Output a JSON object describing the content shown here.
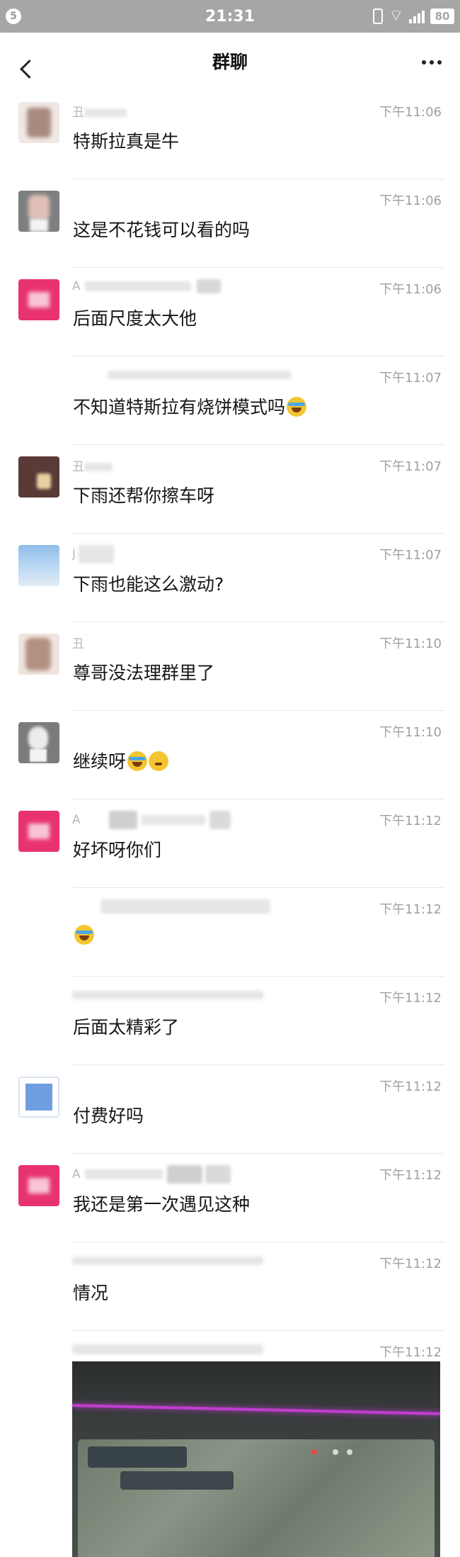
{
  "status_bar": {
    "notification_badge": "5",
    "time": "21:31",
    "battery": "80"
  },
  "header": {
    "title": "群聊"
  },
  "messages": [
    {
      "time": "下午11:06",
      "text": "特斯拉真是牛",
      "sender_prefix": "丑"
    },
    {
      "time": "下午11:06",
      "text": "这是不花钱可以看的吗",
      "sender_prefix": ""
    },
    {
      "time": "下午11:06",
      "text": "后面尺度太大他",
      "sender_prefix": "A"
    },
    {
      "time": "下午11:07",
      "text": "不知道特斯拉有烧饼模式吗",
      "sender_prefix": ""
    },
    {
      "time": "下午11:07",
      "text": "下雨还帮你擦车呀",
      "sender_prefix": "丑"
    },
    {
      "time": "下午11:07",
      "text": "下雨也能这么激动?",
      "sender_prefix": "J"
    },
    {
      "time": "下午11:10",
      "text": "尊哥没法理群里了",
      "sender_prefix": "丑"
    },
    {
      "time": "下午11:10",
      "text": "继续呀",
      "sender_prefix": ""
    },
    {
      "time": "下午11:12",
      "text": "好坏呀你们",
      "sender_prefix": "A"
    },
    {
      "time": "下午11:12",
      "text": "",
      "sender_prefix": ""
    },
    {
      "time": "下午11:12",
      "text": "后面太精彩了",
      "sender_prefix": ""
    },
    {
      "time": "下午11:12",
      "text": "付费好吗",
      "sender_prefix": ""
    },
    {
      "time": "下午11:12",
      "text": "我还是第一次遇见这种",
      "sender_prefix": "A"
    },
    {
      "time": "下午11:12",
      "text": "情况",
      "sender_prefix": ""
    },
    {
      "time": "下午11:12",
      "text": "",
      "sender_prefix": ""
    }
  ],
  "colors": {
    "status_bar_bg": "#a6a6a6",
    "time_text": "#a0a0a0",
    "sender_text": "#b9b9b9",
    "avatar_pink": "#e8336f",
    "photo_accent": "#c13dcf"
  },
  "icons": {
    "back": "back-arrow-icon",
    "more": "more-dots-icon",
    "emoji_laugh": "laugh-tears-emoji",
    "emoji_ok": "ok-hand-emoji"
  }
}
